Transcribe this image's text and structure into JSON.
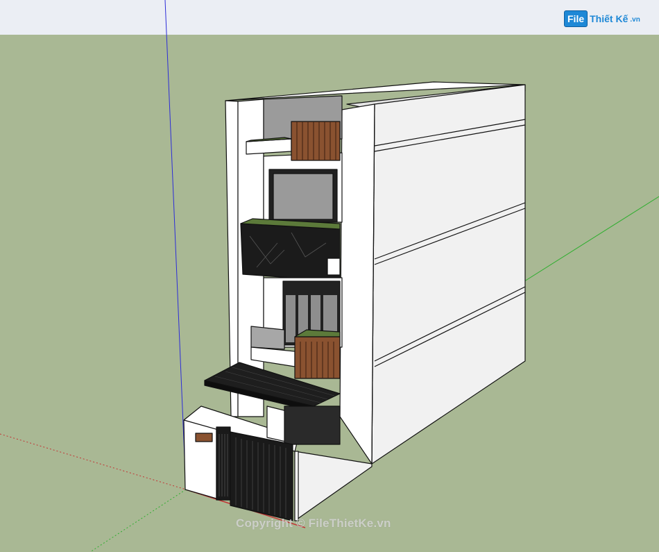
{
  "watermark": {
    "logo_badge": "File",
    "logo_text": "Thiết Kế",
    "logo_tld": ".vn",
    "copyright": "Copyright © FileThietKe.vn"
  },
  "colors": {
    "sky": "#ebeef4",
    "ground": "#a9b894",
    "wall": "#ffffff",
    "wall_side": "#f1f1f1",
    "wood": "#8a5230",
    "marble": "#1b1b1b",
    "grass": "#5c7a3a",
    "glass": "#9a9a9a",
    "axis_blue": "#2c2cd8",
    "axis_green": "#2fae2f",
    "axis_red": "#c23434",
    "logo": "#1e88d6"
  },
  "icons": {
    "logo": "filethietke-logo-icon"
  }
}
